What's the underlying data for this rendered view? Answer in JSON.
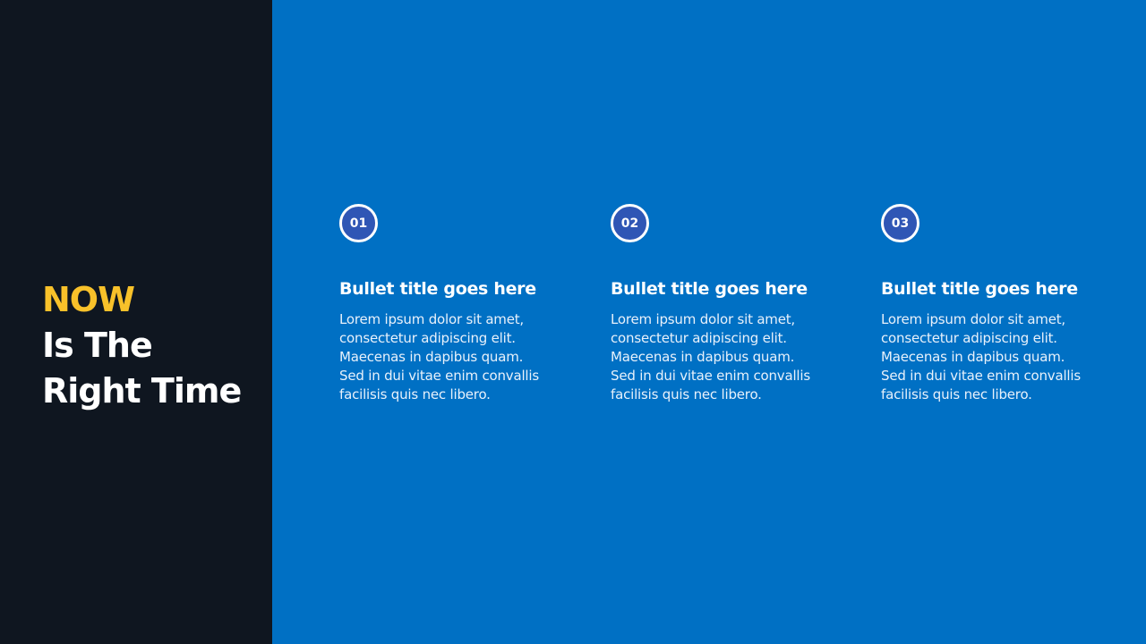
{
  "slide": {
    "headline": {
      "line1": "NOW",
      "line2": "Is The",
      "line3": "Right Time"
    },
    "colors": {
      "left_bg": "#0f1620",
      "right_bg": "#0070c4",
      "accent": "#f8c12a",
      "badge_fill": "#2f56b5",
      "text": "#ffffff"
    },
    "columns": [
      {
        "number": "01",
        "title": "Bullet title goes here",
        "body": [
          "Lorem ipsum dolor sit amet,",
          "consectetur adipiscing elit.",
          "Maecenas in dapibus quam.",
          "Sed in dui vitae enim convallis",
          "facilisis quis nec libero."
        ]
      },
      {
        "number": "02",
        "title": "Bullet title goes here",
        "body": [
          "Lorem ipsum dolor sit amet,",
          "consectetur adipiscing elit.",
          "Maecenas in dapibus quam.",
          "Sed in dui vitae enim convallis",
          "facilisis quis nec libero."
        ]
      },
      {
        "number": "03",
        "title": "Bullet title goes here",
        "body": [
          "Lorem ipsum dolor sit amet,",
          "consectetur adipiscing elit.",
          "Maecenas in dapibus quam.",
          "Sed in dui vitae enim convallis",
          "facilisis quis nec libero."
        ]
      }
    ]
  }
}
